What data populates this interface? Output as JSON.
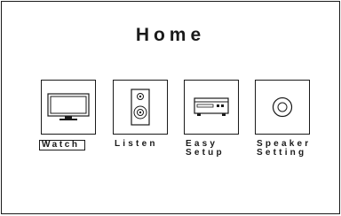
{
  "header": {
    "title": "Home"
  },
  "menu": {
    "items": [
      {
        "label": "Watch",
        "icon": "tv-icon",
        "selected": true
      },
      {
        "label": "Listen",
        "icon": "speaker-icon",
        "selected": false
      },
      {
        "label": "Easy\nSetup",
        "icon": "receiver-icon",
        "selected": false
      },
      {
        "label": "Speaker\nSetting",
        "icon": "disc-speaker-icon",
        "selected": false
      }
    ]
  }
}
